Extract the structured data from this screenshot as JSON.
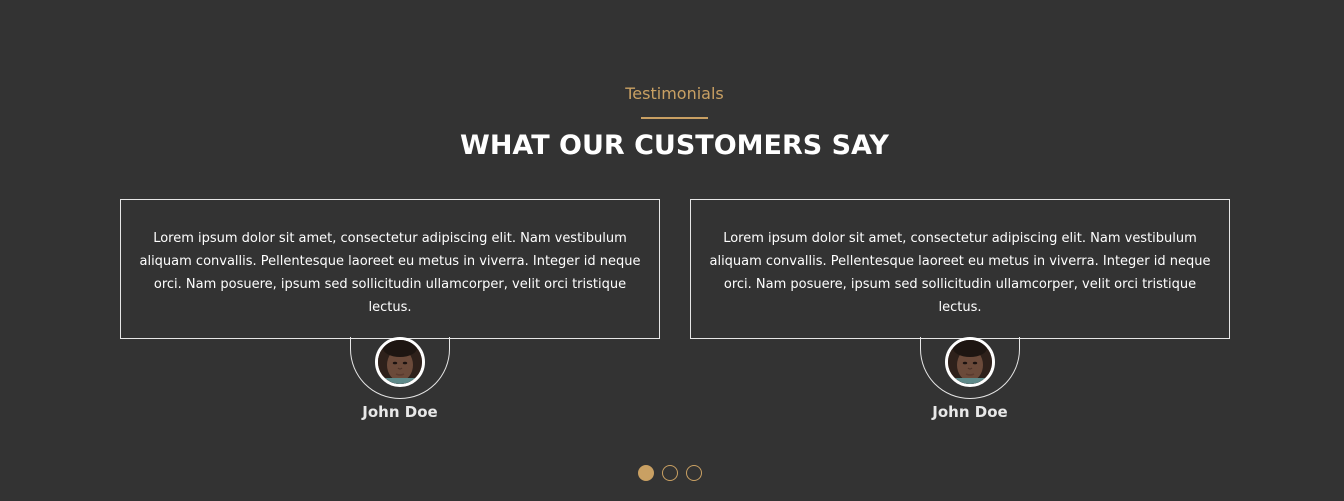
{
  "section": {
    "eyebrow": "Testimonials",
    "heading": "WHAT OUR CUSTOMERS SAY"
  },
  "testimonials": [
    {
      "quote": "Lorem ipsum dolor sit amet, consectetur adipiscing elit. Nam vestibulum aliquam convallis. Pellentesque laoreet eu metus in viverra. Integer id neque orci. Nam posuere, ipsum sed sollicitudin ullamcorper, velit orci tristique lectus.",
      "name": "John Doe",
      "avatar_icon": "customer-photo"
    },
    {
      "quote": "Lorem ipsum dolor sit amet, consectetur adipiscing elit. Nam vestibulum aliquam convallis. Pellentesque laoreet eu metus in viverra. Integer id neque orci. Nam posuere, ipsum sed sollicitudin ullamcorper, velit orci tristique lectus.",
      "name": "John Doe",
      "avatar_icon": "customer-photo"
    }
  ],
  "pagination": {
    "count": 3,
    "active_index": 0
  },
  "colors": {
    "background": "#333333",
    "accent": "#c9a063",
    "text": "#ffffff",
    "border": "#e6e6e6"
  }
}
